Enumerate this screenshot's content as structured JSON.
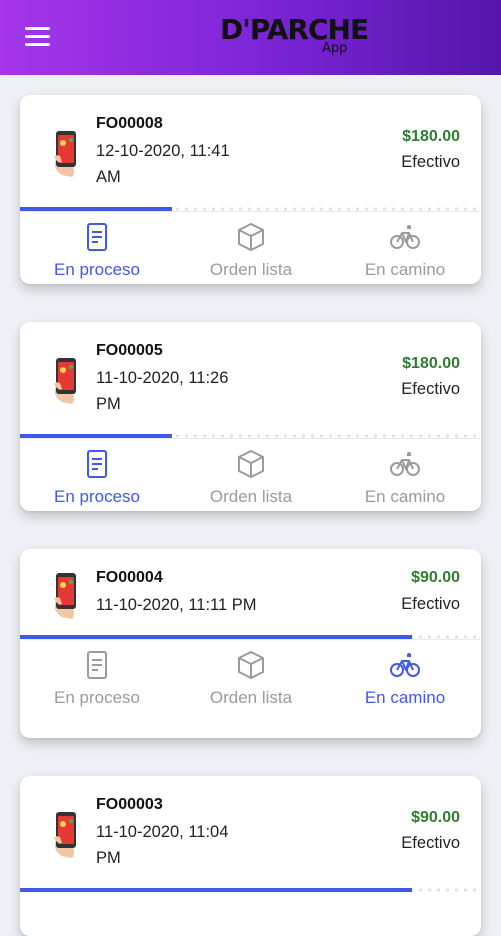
{
  "app": {
    "logo_text": "D'PARCHE",
    "logo_sub": "App"
  },
  "steps": [
    "En proceso",
    "Orden lista",
    "En camino"
  ],
  "orders": [
    {
      "id": "FO00008",
      "date_line1": "12-10-2020, 11:41",
      "date_line2": "AM",
      "amount": "$180.00",
      "method": "Efectivo",
      "progress": 0.33,
      "active_step": 0
    },
    {
      "id": "FO00005",
      "date_line1": "11-10-2020, 11:26",
      "date_line2": "PM",
      "amount": "$180.00",
      "method": "Efectivo",
      "progress": 0.33,
      "active_step": 0
    },
    {
      "id": "FO00004",
      "date_line1": "11-10-2020, 11:11 PM",
      "date_line2": "",
      "amount": "$90.00",
      "method": "Efectivo",
      "progress": 0.85,
      "active_step": 2
    },
    {
      "id": "FO00003",
      "date_line1": "11-10-2020, 11:04",
      "date_line2": "PM",
      "amount": "$90.00",
      "method": "Efectivo",
      "progress": 0.85,
      "active_step": 2
    }
  ],
  "colors": {
    "header_start": "#a535e9",
    "header_end": "#5515a8",
    "accent": "#4059e6",
    "amount": "#2e7d32",
    "inactive": "#9b9b9b"
  }
}
